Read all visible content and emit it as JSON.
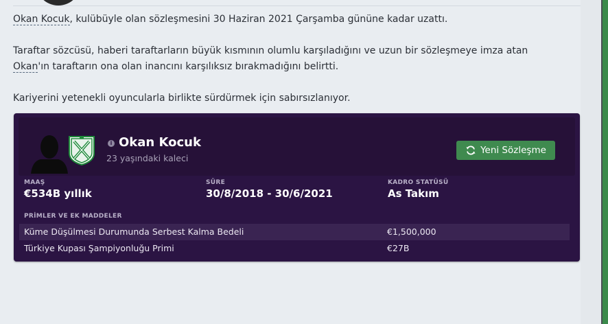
{
  "news": {
    "p1": {
      "link": "Okan Kocuk",
      "rest": ", kulübüyle olan sözleşmesini 30 Haziran 2021 Çarşamba gününe kadar uzattı."
    },
    "p2": {
      "pre": "Taraftar sözcüsü, haberi taraftarların büyük kısmının olumlu karşıladığını ve uzun bir sözleşmeye imza atan ",
      "link": "Okan",
      "post": "'ın taraftarın ona olan inancını karşılıksız bırakmadığını belirtti."
    },
    "p3": "Kariyerini yetenekli oyuncularla birlikte sürdürmek için sabırsızlanıyor."
  },
  "player": {
    "name": "Okan Kocuk",
    "subtitle": "23 yaşındaki kaleci",
    "info_icon": "i"
  },
  "renew_button": {
    "label": "Yeni Sözleşme",
    "icon": "refresh-icon"
  },
  "contract": {
    "salary_label": "MAAŞ",
    "salary_value": "€534B yıllık",
    "term_label": "SÜRE",
    "term_value": "30/8/2018 - 30/6/2021",
    "squad_label": "KADRO STATÜSÜ",
    "squad_value": "As Takım"
  },
  "bonuses": {
    "title": "PRİMLER VE EK MADDELER",
    "rows": [
      {
        "name": "Küme Düşülmesi Durumunda Serbest Kalma Bedeli",
        "value": "€1,500,000"
      },
      {
        "name": "Türkiye Kupası Şampiyonluğu Primi",
        "value": "€27B"
      }
    ]
  },
  "colors": {
    "card_bg": "#2b1443",
    "button_green": "#3f8a4f",
    "page_bg": "#e9edf1",
    "sidebar_green": "#3b8a4b"
  }
}
